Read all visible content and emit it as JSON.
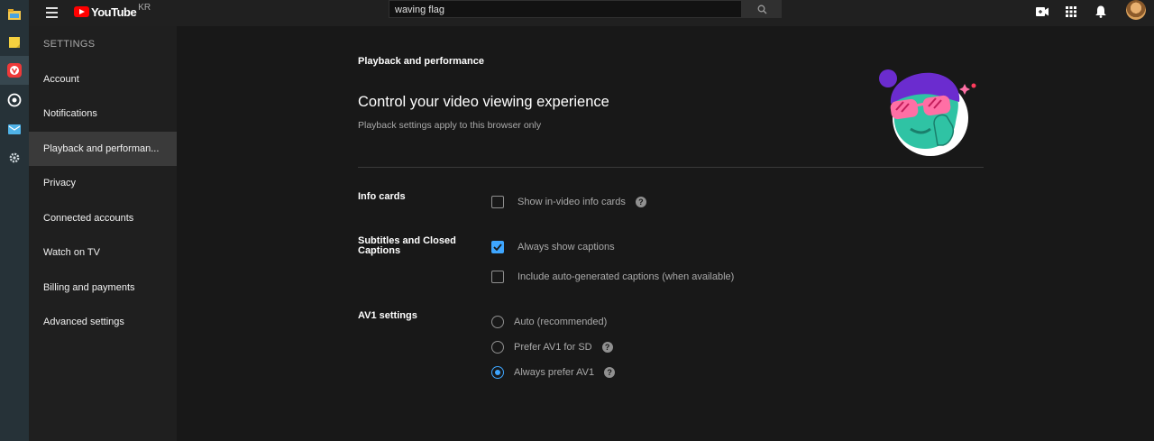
{
  "os_bar": {
    "icons": [
      "folder-icon",
      "notes-icon",
      "vivaldi-icon",
      "target-icon",
      "mail-icon",
      "gear-icon"
    ]
  },
  "header": {
    "logo_text": "YouTube",
    "logo_region": "KR",
    "search": {
      "value": "waving flag",
      "placeholder": "Search"
    }
  },
  "nav": {
    "title": "SETTINGS",
    "items": [
      {
        "label": "Account"
      },
      {
        "label": "Notifications"
      },
      {
        "label": "Playback and performan..."
      },
      {
        "label": "Privacy"
      },
      {
        "label": "Connected accounts"
      },
      {
        "label": "Watch on TV"
      },
      {
        "label": "Billing and payments"
      },
      {
        "label": "Advanced settings"
      }
    ],
    "selected_index": 2
  },
  "main": {
    "section_label": "Playback and performance",
    "heading": "Control your video viewing experience",
    "subheading": "Playback settings apply to this browser only",
    "info_cards": {
      "label": "Info cards",
      "options": [
        {
          "label": "Show in-video info cards",
          "checked": false
        }
      ]
    },
    "captions": {
      "label": "Subtitles and Closed Captions",
      "options": [
        {
          "label": "Always show captions",
          "checked": true
        },
        {
          "label": "Include auto-generated captions (when available)",
          "checked": false
        }
      ]
    },
    "av1": {
      "label": "AV1 settings",
      "options": [
        {
          "label": "Auto (recommended)",
          "selected": false
        },
        {
          "label": "Prefer AV1 for SD",
          "selected": false
        },
        {
          "label": "Always prefer AV1",
          "selected": true
        }
      ]
    }
  },
  "colors": {
    "accent": "#3ea6ff",
    "brand_red": "#ff0000",
    "background": "#181818",
    "nav_background": "#1f1f1f"
  }
}
